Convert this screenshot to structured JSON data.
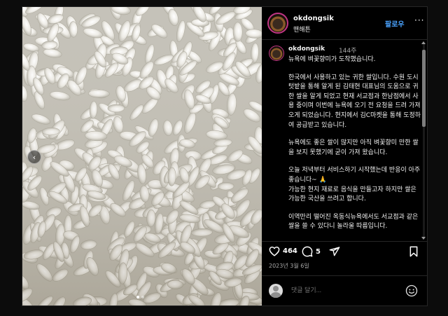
{
  "post": {
    "username": "okdongsik",
    "subtitle": "맨해튼",
    "follow_label": "팔로우",
    "more_label": "···"
  },
  "caption": {
    "username": "okdongsik",
    "time": "144주",
    "paragraphs": [
      "뉴욕에 벼꽃향미가 도착했습니다.",
      "한국에서 사용하고 있는 귀한 쌀입니다. 수원 도시텃밭을 통해 알게 된 김태현 대표님의 도움으로 귀한 쌀을 알게 되었고 현재 서교점과 한남점에서 사용 중이며 이번에 뉴욕에 오기 전 요청을 드려 가져오게 되었습니다. 현지에서 김C마켓을 통해 도정하여 공급받고 있습니다.",
      "뉴욕에도 좋은 쌀이 많지만 아직 벼꽃향미 만한 쌀을 보지 못했기에 굳이 가져 왔습니다.",
      "오늘 저녁부터 서비스하기 시작했는데 반응이 아주 좋습니다~ 🙏\n가능한 현지 재료로 음식을 만들고자 하지만 쌀은 가능한 국산을 쓰려고 합니다.",
      "이역만리 떨어진 옥동식뉴욕에서도 서교점과 같은 쌀을 쓸 수 있다니 놀라울 따름입니다."
    ]
  },
  "actions": {
    "like_count": "464",
    "comment_count": "5",
    "date": "2023년 3월 6일"
  },
  "add_comment": {
    "placeholder": "댓글 달기..."
  },
  "carousel": {
    "dot_count": 2,
    "active_index": 0
  },
  "colors": {
    "background": "#000000",
    "follow": "#4aa3ff",
    "muted": "#a8a8a8",
    "border": "#262626"
  },
  "icons": [
    "chevron-left-icon",
    "heart-icon",
    "comment-icon",
    "share-icon",
    "bookmark-icon",
    "emoji-icon",
    "more-icon"
  ]
}
